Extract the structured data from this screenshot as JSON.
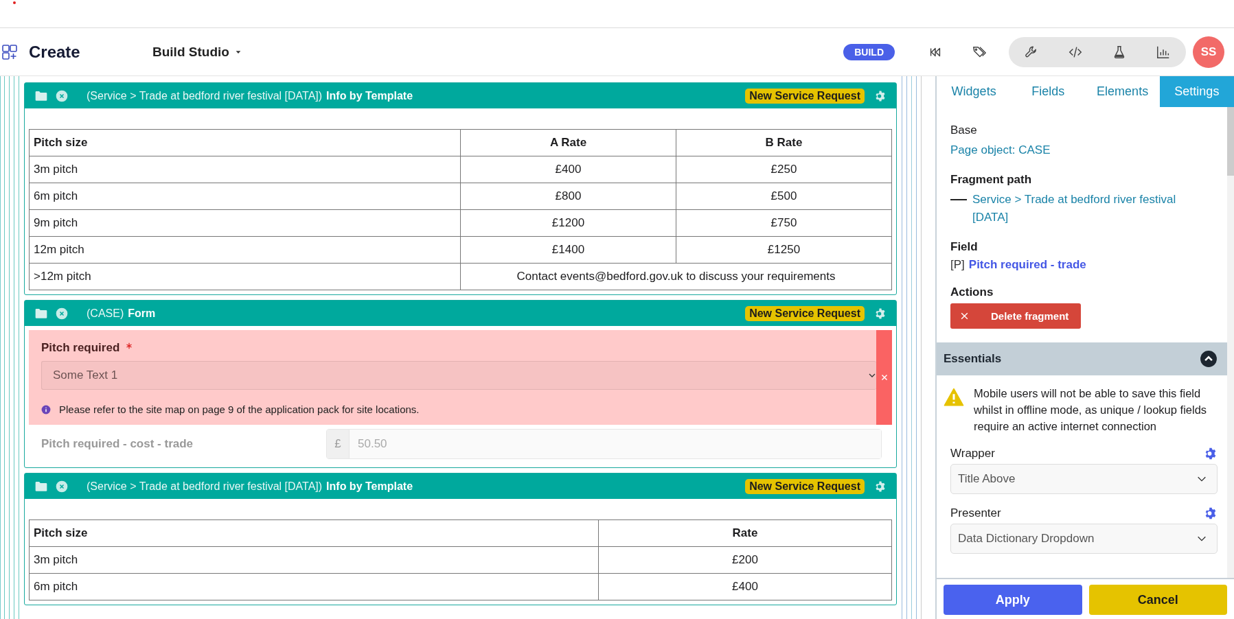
{
  "app": {
    "title": "Create",
    "studio": "Build Studio",
    "mode_badge": "BUILD",
    "avatar": "SS"
  },
  "fragments": [
    {
      "kind": "table",
      "path": "(Service > Trade at bedford river festival [DATA])",
      "title": "Info by Template",
      "badge": "New Service Request",
      "columns": [
        "Pitch size",
        "A Rate",
        "B Rate"
      ],
      "rows": [
        [
          "3m pitch",
          "£400",
          "£250"
        ],
        [
          "6m pitch",
          "£800",
          "£500"
        ],
        [
          "9m pitch",
          "£1200",
          "£750"
        ],
        [
          "12m pitch",
          "£1400",
          "£1250"
        ],
        [
          ">12m pitch",
          {
            "text": "Contact events@bedford.gov.uk to discuss your requirements",
            "colspan": 2
          }
        ]
      ]
    },
    {
      "kind": "form",
      "path": "(CASE)",
      "title": "Form",
      "badge": "New Service Request",
      "fields": [
        {
          "kind": "select",
          "label": "Pitch required",
          "required": true,
          "error": true,
          "value": "Some Text 1",
          "help": "Please refer to the site map on page 9 of the application pack for site locations."
        },
        {
          "kind": "currency",
          "label": "Pitch required - cost - trade",
          "disabled": true,
          "prefix": "£",
          "value": "50.50"
        }
      ]
    },
    {
      "kind": "table",
      "path": "(Service > Trade at bedford river festival [DATA])",
      "title": "Info by Template",
      "badge": "New Service Request",
      "columns": [
        "Pitch size",
        "Rate"
      ],
      "rows": [
        [
          "3m pitch",
          "£200"
        ],
        [
          "6m pitch",
          "£400"
        ]
      ]
    }
  ],
  "side_panel": {
    "tabs": [
      {
        "label": "Widgets",
        "selected": false
      },
      {
        "label": "Fields",
        "selected": false
      },
      {
        "label": "Elements",
        "selected": false
      },
      {
        "label": "Settings",
        "selected": true
      }
    ],
    "base": {
      "heading": "Base",
      "link": "Page object: CASE"
    },
    "fragment_path": {
      "heading": "Fragment path",
      "link": "Service > Trade at bedford river festival [DATA]"
    },
    "field": {
      "heading": "Field",
      "prefix": "[P]",
      "link": "Pitch required - trade"
    },
    "actions": {
      "heading": "Actions",
      "button": "Delete fragment"
    },
    "essentials": {
      "heading": "Essentials",
      "expanded": true,
      "warning": "Mobile users will not be able to save this field whilst in offline mode, as unique / lookup fields require an active internet connection",
      "selects": [
        {
          "label": "Wrapper",
          "value": "Title Above"
        },
        {
          "label": "Presenter",
          "value": "Data Dictionary Dropdown"
        }
      ]
    },
    "footer": {
      "apply": "Apply",
      "cancel": "Cancel"
    }
  }
}
